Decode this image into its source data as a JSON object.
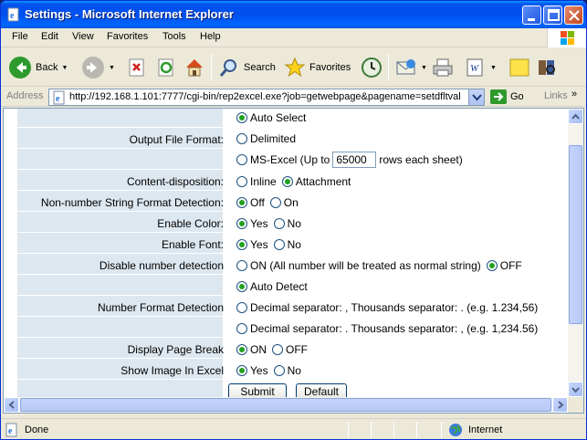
{
  "window": {
    "title": "Settings - Microsoft Internet Explorer"
  },
  "menu": [
    "File",
    "Edit",
    "View",
    "Favorites",
    "Tools",
    "Help"
  ],
  "toolbar": {
    "back": "Back",
    "search": "Search",
    "favorites": "Favorites"
  },
  "address": {
    "label": "Address",
    "url": "http://192.168.1.101:7777/cgi-bin/rep2excel.exe?job=getwebpage&pagename=setdfltval",
    "go": "Go",
    "links": "Links"
  },
  "form": {
    "output_format": {
      "label": "Output File Format:",
      "opt_auto": "Auto Select",
      "opt_delimited": "Delimited",
      "opt_msexcel_prefix": "MS-Excel (Up to",
      "rows_value": "65000",
      "opt_msexcel_suffix": "rows each sheet)",
      "selected": "Auto Select"
    },
    "content_disposition": {
      "label": "Content-disposition:",
      "opt_inline": "Inline",
      "opt_attachment": "Attachment",
      "selected": "Attachment"
    },
    "non_number": {
      "label": "Non-number String Format Detection:",
      "opt_off": "Off",
      "opt_on": "On",
      "selected": "Off"
    },
    "enable_color": {
      "label": "Enable Color:",
      "opt_yes": "Yes",
      "opt_no": "No",
      "selected": "Yes"
    },
    "enable_font": {
      "label": "Enable Font:",
      "opt_yes": "Yes",
      "opt_no": "No",
      "selected": "Yes"
    },
    "disable_number": {
      "label": "Disable number detection",
      "opt_on": "ON (All number will be treated as normal string)",
      "opt_off": "OFF",
      "selected": "OFF"
    },
    "number_format": {
      "label": "Number Format Detection",
      "opt_auto": "Auto Detect",
      "opt_a": "Decimal separator: , Thousands separator: . (e.g. 1.234,56)",
      "opt_b": "Decimal separator: . Thousands separator: , (e.g. 1,234.56)",
      "selected": "Auto Detect"
    },
    "page_break": {
      "label": "Display Page Break",
      "opt_on": "ON",
      "opt_off": "OFF",
      "selected": "ON"
    },
    "show_image": {
      "label": "Show Image In Excel",
      "opt_yes": "Yes",
      "opt_no": "No",
      "selected": "Yes"
    },
    "submit": "Submit",
    "default": "Default"
  },
  "status": {
    "text": "Done",
    "zone": "Internet"
  }
}
